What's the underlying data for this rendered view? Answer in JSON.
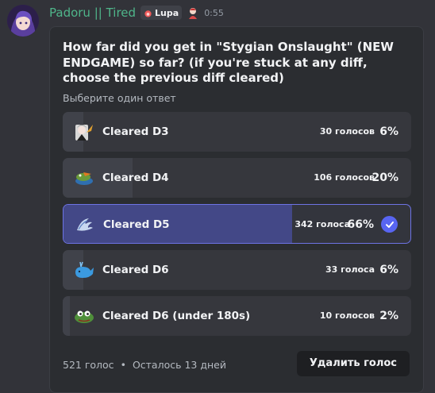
{
  "message": {
    "username": "Padoru || Tired",
    "tag_label": "Lupa",
    "timestamp": "0:55",
    "username_color": "#4fb58a"
  },
  "poll": {
    "question": "How far did you get in \"Stygian Onslaught\" (NEW ENDGAME) so far? (if you're stuck at any diff, choose the previous diff cleared)",
    "hint": "Выберите один ответ",
    "accent_color": "#5865f2",
    "answers": [
      {
        "label": "Cleared D3",
        "votes": "30 голосов",
        "percent": "6%",
        "fraction": 0.06,
        "icon": "anime-character-emoji",
        "selected": false
      },
      {
        "label": "Cleared D4",
        "votes": "106 голосов",
        "percent": "20%",
        "fraction": 0.2,
        "icon": "frog-emoji",
        "selected": false
      },
      {
        "label": "Cleared D5",
        "votes": "342 голоса",
        "percent": "66%",
        "fraction": 0.66,
        "icon": "wing-emoji",
        "selected": true
      },
      {
        "label": "Cleared D6",
        "votes": "33 голоса",
        "percent": "6%",
        "fraction": 0.06,
        "icon": "whale-emoji",
        "selected": false
      },
      {
        "label": "Cleared D6 (under 180s)",
        "votes": "10 голосов",
        "percent": "2%",
        "fraction": 0.02,
        "icon": "pepe-frog-emoji",
        "selected": false
      }
    ],
    "total_votes": "521 голос",
    "separator": "•",
    "time_left": "Осталось 13 дней",
    "remove_vote_label": "Удалить голос"
  }
}
